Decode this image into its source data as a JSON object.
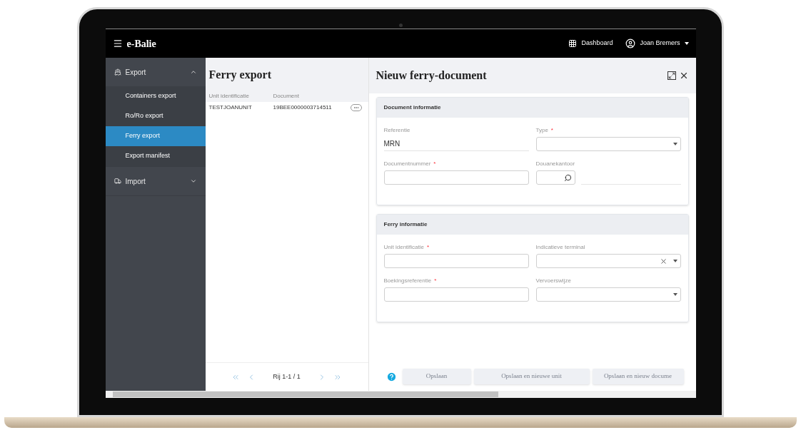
{
  "topbar": {
    "app_title": "e-Balie",
    "dashboard": "Dashboard",
    "user": "Joan Bremers"
  },
  "sidebar": {
    "groups": [
      {
        "label": "Export",
        "expanded": true,
        "items": [
          {
            "label": "Containers export",
            "selected": false
          },
          {
            "label": "Ro/Ro export",
            "selected": false
          },
          {
            "label": "Ferry export",
            "selected": true
          },
          {
            "label": "Export manifest",
            "selected": false
          }
        ]
      },
      {
        "label": "Import",
        "expanded": false
      }
    ]
  },
  "list": {
    "title": "Ferry export",
    "columns": [
      "Unit identificatie",
      "Document"
    ],
    "rows": [
      {
        "cells": [
          "TESTJOANUNIT",
          "19BEE0000003714511"
        ]
      }
    ],
    "pager": "Rij 1-1 / 1"
  },
  "form": {
    "title": "Nieuw ferry-document",
    "sections": [
      {
        "title": "Document informatie",
        "fields": [
          {
            "kind": "readonly",
            "label": "Referentie",
            "value": "MRN"
          },
          {
            "kind": "select",
            "label": "Type",
            "required_mark": "*",
            "clearable": false
          },
          {
            "kind": "text",
            "label": "Documentnummer",
            "required_mark": "*"
          },
          {
            "kind": "search",
            "label": "Douanekantoor"
          }
        ]
      },
      {
        "title": "Ferry informatie",
        "fields": [
          {
            "kind": "text",
            "label": "Unit identificatie",
            "required_mark": "*"
          },
          {
            "kind": "select",
            "label": "Indicatieve terminal",
            "clearable": true
          },
          {
            "kind": "text",
            "label": "Boekingsreferentie",
            "required_mark": "*"
          },
          {
            "kind": "select",
            "label": "Vervoerswijze",
            "clearable": false
          }
        ]
      }
    ],
    "buttons": [
      {
        "label": "Opslaan",
        "disabled": true
      },
      {
        "label": "Opslaan en nieuwe unit",
        "disabled": true
      },
      {
        "label": "Opslaan en nieuw docume",
        "disabled": true
      }
    ]
  }
}
